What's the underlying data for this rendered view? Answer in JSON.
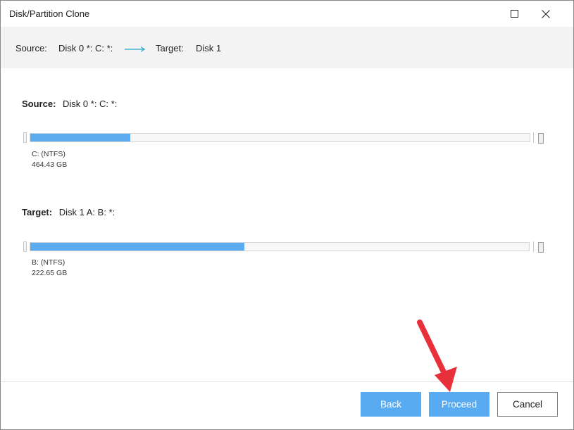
{
  "window": {
    "title": "Disk/Partition Clone",
    "maximize_icon": "maximize-icon",
    "close_icon": "close-icon"
  },
  "infobar": {
    "source_label": "Source:",
    "source_value": "Disk 0 *: C: *:",
    "arrow_icon": "right-arrow-icon",
    "target_label": "Target:",
    "target_value": "Disk 1"
  },
  "source": {
    "label": "Source:",
    "value": "Disk 0 *: C: *:",
    "partition_name": "C: (NTFS)",
    "partition_size": "464.43 GB",
    "used_fraction": 0.2
  },
  "target": {
    "label": "Target:",
    "value": "Disk 1 A: B: *:",
    "partition_name": "B: (NTFS)",
    "partition_size": "222.65 GB",
    "used_fraction": 0.43
  },
  "footer": {
    "back_label": "Back",
    "proceed_label": "Proceed",
    "cancel_label": "Cancel"
  },
  "colors": {
    "accent": "#59abf1",
    "annotation": "#e8303a",
    "infobar_bg": "#f3f3f3"
  }
}
